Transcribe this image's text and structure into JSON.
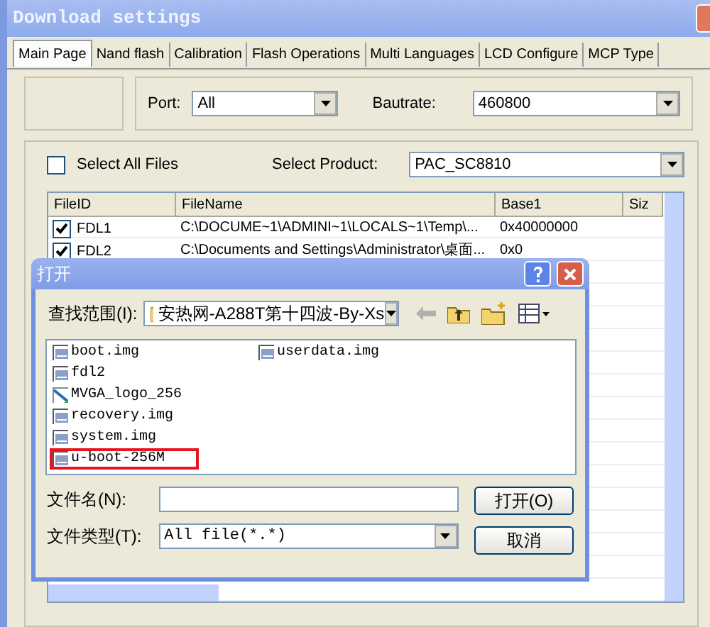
{
  "window": {
    "title": "Download settings"
  },
  "tabs": [
    {
      "label": "Main Page",
      "selected": true
    },
    {
      "label": "Nand flash",
      "selected": false
    },
    {
      "label": "Calibration",
      "selected": false
    },
    {
      "label": "Flash Operations",
      "selected": false
    },
    {
      "label": "Multi Languages",
      "selected": false
    },
    {
      "label": "LCD Configure",
      "selected": false
    },
    {
      "label": "MCP Type",
      "selected": false
    }
  ],
  "port": {
    "label": "Port:",
    "value": "All"
  },
  "bautrate": {
    "label": "Bautrate:",
    "value": "460800"
  },
  "select_all": {
    "label": "Select All Files",
    "checked": false
  },
  "product": {
    "label": "Select Product:",
    "value": "PAC_SC8810"
  },
  "table": {
    "columns": [
      "FileID",
      "FileName",
      "Base1",
      "Siz"
    ],
    "rows": [
      {
        "checked": true,
        "file_id": "FDL1",
        "file_name": "C:\\DOCUME~1\\ADMINI~1\\LOCALS~1\\Temp\\...",
        "base1": "0x40000000"
      },
      {
        "checked": true,
        "file_id": "FDL2",
        "file_name": "C:\\Documents and Settings\\Administrator\\桌面...",
        "base1": "0x0"
      }
    ]
  },
  "dialog": {
    "title": "打开",
    "look_in": {
      "label": "查找范围(I):",
      "value": "安热网-A288T第十四波-By-Xs"
    },
    "files": [
      {
        "name": "boot.img",
        "kind": "file",
        "highlighted": false
      },
      {
        "name": "fdl2",
        "kind": "file",
        "highlighted": false
      },
      {
        "name": "MVGA_logo_256",
        "kind": "image",
        "highlighted": false
      },
      {
        "name": "recovery.img",
        "kind": "file",
        "highlighted": false
      },
      {
        "name": "system.img",
        "kind": "file",
        "highlighted": false
      },
      {
        "name": "u-boot-256M",
        "kind": "file",
        "highlighted": true
      },
      {
        "name": "userdata.img",
        "kind": "file",
        "highlighted": false
      }
    ],
    "file_name": {
      "label": "文件名(N):"
    },
    "file_type": {
      "label": "文件类型(T):",
      "value": "All file(*.*)"
    },
    "buttons": [
      "打开(O)",
      "取消"
    ]
  }
}
